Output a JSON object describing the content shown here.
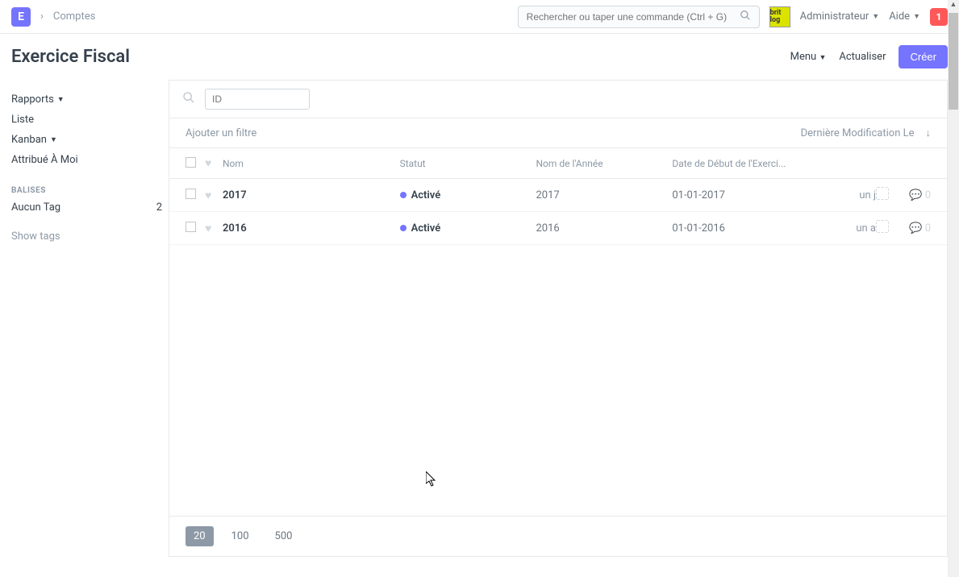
{
  "topbar": {
    "logo": "E",
    "breadcrumb": "Comptes",
    "search_placeholder": "Rechercher ou taper une commande (Ctrl + G)",
    "brand": "brit log",
    "user": "Administrateur",
    "help": "Aide",
    "notif_count": "1"
  },
  "page": {
    "title": "Exercice Fiscal",
    "menu": "Menu",
    "refresh": "Actualiser",
    "create": "Créer"
  },
  "sidebar": {
    "reports": "Rapports",
    "list": "Liste",
    "kanban": "Kanban",
    "assigned": "Attribué À Moi",
    "tags_header": "BALISES",
    "no_tag": "Aucun Tag",
    "no_tag_count": "2",
    "show_tags": "Show tags"
  },
  "filters": {
    "id_placeholder": "ID",
    "add_filter": "Ajouter un filtre",
    "sort_by": "Dernière Modification Le"
  },
  "columns": {
    "name": "Nom",
    "status": "Statut",
    "year_name": "Nom de l'Année",
    "start_date": "Date de Début de l'Exerci..."
  },
  "rows": [
    {
      "name": "2017",
      "status": "Activé",
      "year": "2017",
      "date": "01-01-2017",
      "time": "un j",
      "comments": "0"
    },
    {
      "name": "2016",
      "status": "Activé",
      "year": "2016",
      "date": "01-01-2016",
      "time": "un a",
      "comments": "0"
    }
  ],
  "pager": {
    "p20": "20",
    "p100": "100",
    "p500": "500"
  }
}
